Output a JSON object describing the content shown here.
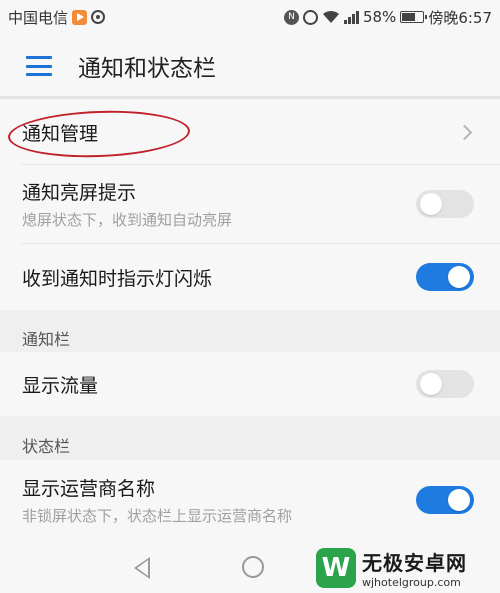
{
  "status_bar": {
    "carrier": "中国电信",
    "battery_percent_text": "58%",
    "battery_level": 0.58,
    "time": "傍晚6:57",
    "icons": [
      "play-badge-icon",
      "circle-app-icon",
      "nfc-icon",
      "alarm-icon",
      "wifi-icon",
      "signal-icon",
      "battery-icon"
    ]
  },
  "header": {
    "menu_icon": "menu-icon",
    "title": "通知和状态栏"
  },
  "items": {
    "notification_management": {
      "title": "通知管理",
      "control": "chevron-right-icon"
    },
    "wake_screen": {
      "title": "通知亮屏提示",
      "subtitle": "熄屏状态下，收到通知自动亮屏",
      "toggle_on": false
    },
    "indicator_light": {
      "title": "收到通知时指示灯闪烁",
      "toggle_on": true
    }
  },
  "sections": {
    "notification_bar": {
      "header": "通知栏",
      "show_traffic": {
        "title": "显示流量",
        "toggle_on": false
      }
    },
    "status_bar": {
      "header": "状态栏",
      "show_carrier": {
        "title": "显示运营商名称",
        "subtitle": "非锁屏状态下，状态栏上显示运营商名称",
        "toggle_on": true
      }
    }
  },
  "nav_bar": {
    "icons": [
      "back-icon",
      "home-icon"
    ]
  },
  "watermark": {
    "logo_letter": "W",
    "name": "无极安卓网",
    "url": "wjhotelgroup.com"
  },
  "colors": {
    "accent": "#1f7be0",
    "highlight": "#c0232c",
    "watermark": "#2aa34a"
  }
}
